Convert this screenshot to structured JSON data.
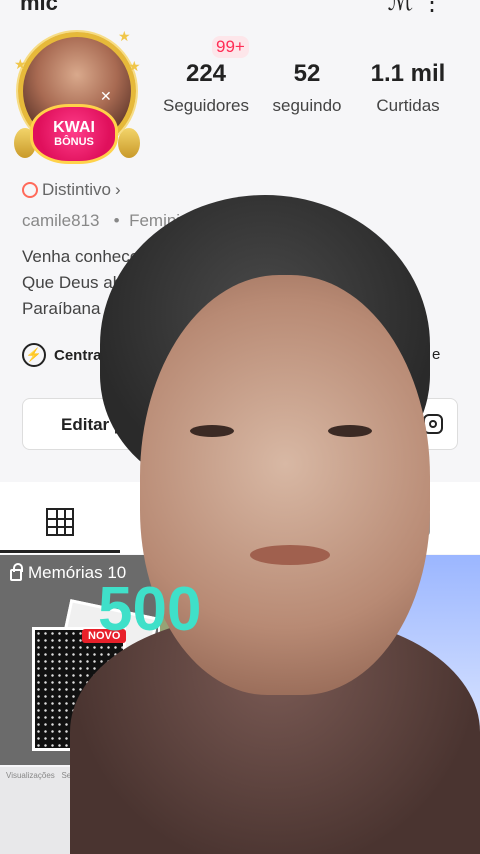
{
  "header": {
    "name_partial": "mic",
    "top_icons": "ℳ ⋮"
  },
  "profile": {
    "avatar_badge_line1": "KWAI",
    "avatar_badge_line2": "BÔNUS",
    "notification_badge": "99+",
    "stats": [
      {
        "value": "224",
        "label": "Seguidores"
      },
      {
        "value": "52",
        "label": "seguindo"
      },
      {
        "value": "1.1 mil",
        "label": "Curtidas"
      }
    ],
    "distintivo_label": "Distintivo",
    "username": "camile813",
    "user_meta": "Feminino",
    "bio_lines": [
      "Venha conhece",
      "Que Deus abe",
      "Paraíbana 🌵"
    ],
    "central_label": "Central",
    "central_right": "e",
    "edit_button_label": "Editar p"
  },
  "content": {
    "memorias_label": "Memórias 10",
    "novo_label": "NOVO",
    "mini_text_1": "Visualizações",
    "mini_text_2": "Seguidores"
  },
  "overlay": {
    "number_text": "500",
    "number_color": "#3fe0c9"
  }
}
